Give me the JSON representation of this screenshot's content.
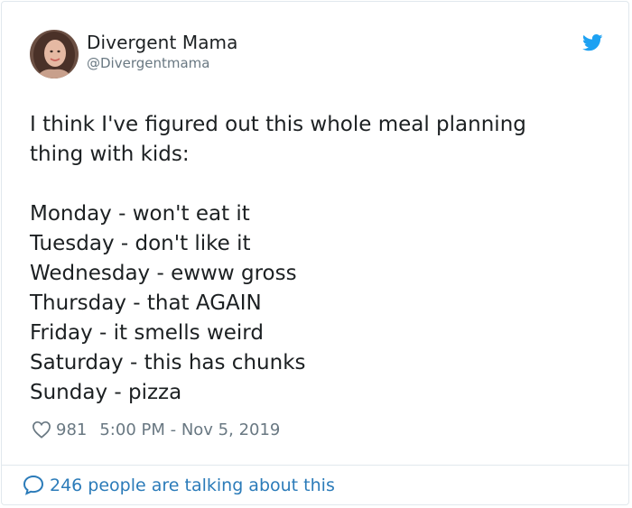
{
  "author": {
    "name": "Divergent Mama",
    "handle": "@Divergentmama"
  },
  "tweet": {
    "intro_lines": [
      "I think I've figured out this whole meal planning",
      "thing with kids:"
    ],
    "days": [
      "Monday - won't eat it",
      "Tuesday - don't like it",
      "Wednesday - ewww gross",
      "Thursday - that AGAIN",
      "Friday - it smells weird",
      "Saturday - this has chunks",
      "Sunday - pizza"
    ]
  },
  "meta": {
    "likes": "981",
    "timestamp": "5:00 PM - Nov 5, 2019"
  },
  "footer": {
    "talking": "246 people are talking about this"
  },
  "icons": {
    "bird": "twitter-bird-icon",
    "heart": "heart-outline-icon",
    "bubble": "speech-bubble-icon"
  },
  "colors": {
    "brand": "#1da1f2",
    "link": "#2b7bb9",
    "muted": "#697882",
    "text": "#1c2022",
    "border": "#e1e8ed"
  }
}
